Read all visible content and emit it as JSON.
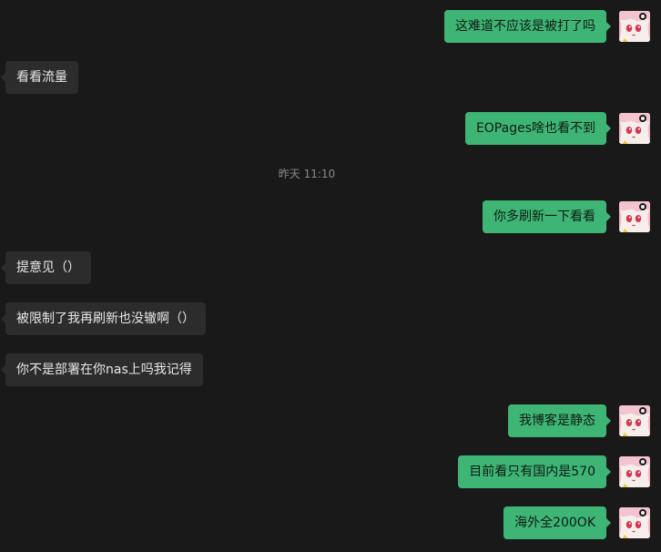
{
  "messages": [
    {
      "direction": "out",
      "text": "这难道不应该是被打了吗"
    },
    {
      "direction": "in",
      "text": "看看流量"
    },
    {
      "direction": "out",
      "text": "EOPages啥也看不到"
    },
    {
      "direction": "out",
      "text": "你多刷新一下看看"
    },
    {
      "direction": "in",
      "text": "提意见（）"
    },
    {
      "direction": "in",
      "text": "被限制了我再刷新也没辙啊（）"
    },
    {
      "direction": "in",
      "text": "你不是部署在你nas上吗我记得"
    },
    {
      "direction": "out",
      "text": "我博客是静态"
    },
    {
      "direction": "out",
      "text": "目前看只有国内是570"
    },
    {
      "direction": "out",
      "text": "海外全200OK"
    }
  ],
  "timestamp": "昨天 11:10",
  "colors": {
    "background": "#191919",
    "outgoing_bubble": "#3eb575",
    "incoming_bubble": "#2c2c2c",
    "timestamp_text": "#8a8a8a"
  },
  "icons": {
    "avatar": "anime-girl-avatar-icon"
  }
}
